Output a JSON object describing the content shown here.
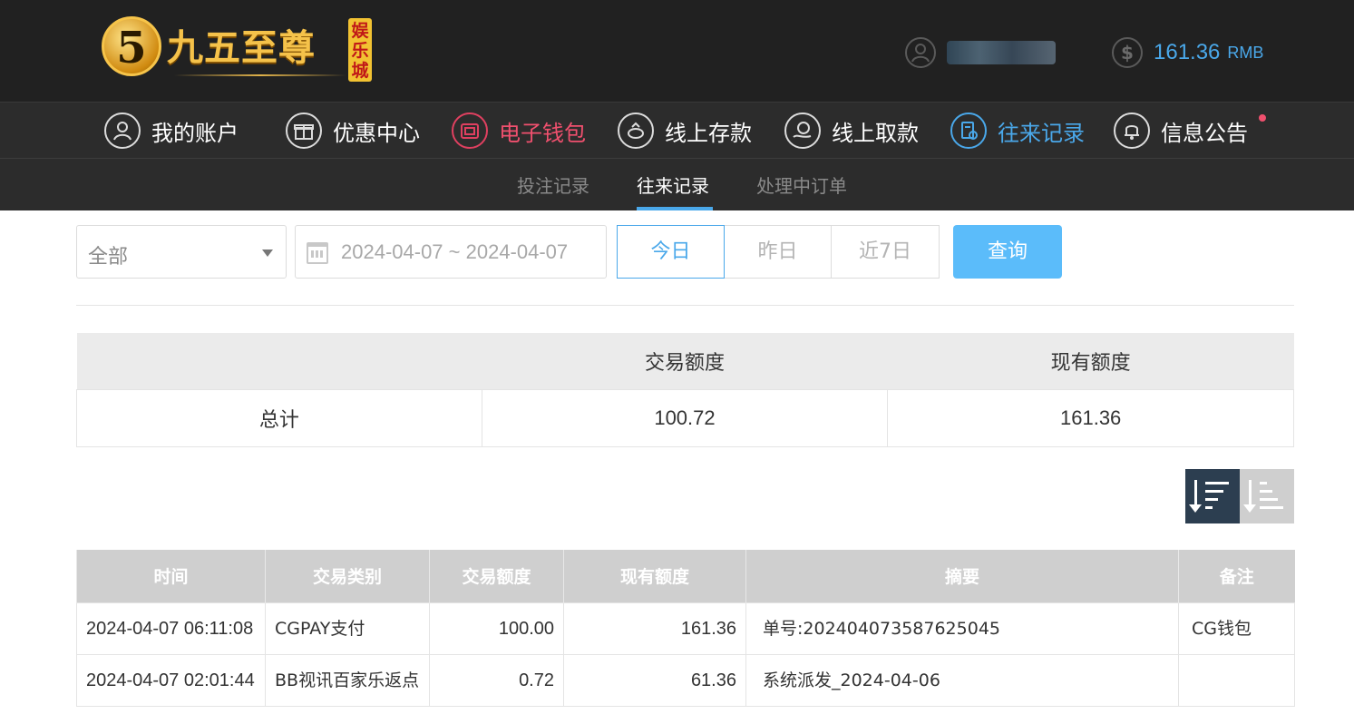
{
  "header": {
    "logo_glyph": "5",
    "logo_text": "九五至尊",
    "logo_badge": "娱乐城",
    "user_icon": "user-circle-icon",
    "balance_icon": "dollar-coin-icon",
    "balance_value": "161.36",
    "balance_unit": "RMB"
  },
  "nav": {
    "items": [
      {
        "label": "我的账户",
        "icon": "user-icon"
      },
      {
        "label": "优惠中心",
        "icon": "gift-icon"
      },
      {
        "label": "电子钱包",
        "icon": "wallet-icon"
      },
      {
        "label": "线上存款",
        "icon": "deposit-icon"
      },
      {
        "label": "线上取款",
        "icon": "withdraw-icon"
      },
      {
        "label": "往来记录",
        "icon": "records-icon"
      },
      {
        "label": "信息公告",
        "icon": "bell-icon"
      }
    ]
  },
  "subnav": {
    "items": [
      "投注记录",
      "往来记录",
      "处理中订单"
    ],
    "active": "往来记录"
  },
  "filters": {
    "type_selected": "全部",
    "date_range": "2024-04-07 ~ 2024-04-07",
    "quick_days": [
      "今日",
      "昨日",
      "近7日"
    ],
    "active_day": "今日",
    "query_label": "查询"
  },
  "summary": {
    "headers": [
      "",
      "交易额度",
      "现有额度"
    ],
    "row": {
      "label": "总计",
      "amount": "100.72",
      "balance": "161.36"
    }
  },
  "sort": {
    "desc_icon": "sort-desc-icon",
    "asc_icon": "sort-asc-icon"
  },
  "transactions": {
    "headers": [
      "时间",
      "交易类别",
      "交易额度",
      "现有额度",
      "摘要",
      "备注"
    ],
    "rows": [
      {
        "time": "2024-04-07 06:11:08",
        "type": "CGPAY支付",
        "amount": "100.00",
        "balance": "161.36",
        "summary": "单号:202404073587625045",
        "note": "CG钱包"
      },
      {
        "time": "2024-04-07 02:01:44",
        "type": "BB视讯百家乐返点",
        "amount": "0.72",
        "balance": "61.36",
        "summary": "系统派发_2024-04-06",
        "note": ""
      }
    ]
  },
  "colors": {
    "accent": "#4aa8ea",
    "alert": "#f0506e",
    "header_bg": "#212121",
    "nav_bg": "#2c2c2c",
    "query_btn": "#5bbcfa"
  }
}
